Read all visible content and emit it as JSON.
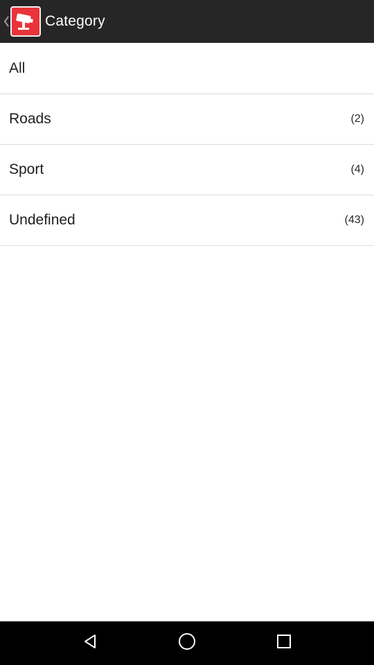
{
  "header": {
    "title": "Category",
    "icon": "speed-camera-icon"
  },
  "categories": [
    {
      "label": "All",
      "count": ""
    },
    {
      "label": "Roads",
      "count": "(2)"
    },
    {
      "label": "Sport",
      "count": "(4)"
    },
    {
      "label": "Undefined",
      "count": "(43)"
    }
  ],
  "navigation": {
    "back": "back-triangle-icon",
    "home": "home-circle-icon",
    "recents": "recents-square-icon"
  },
  "colors": {
    "action_bar": "#262626",
    "app_icon": "#e8343a",
    "divider": "#dcdcdc",
    "nav_bar": "#000000"
  }
}
